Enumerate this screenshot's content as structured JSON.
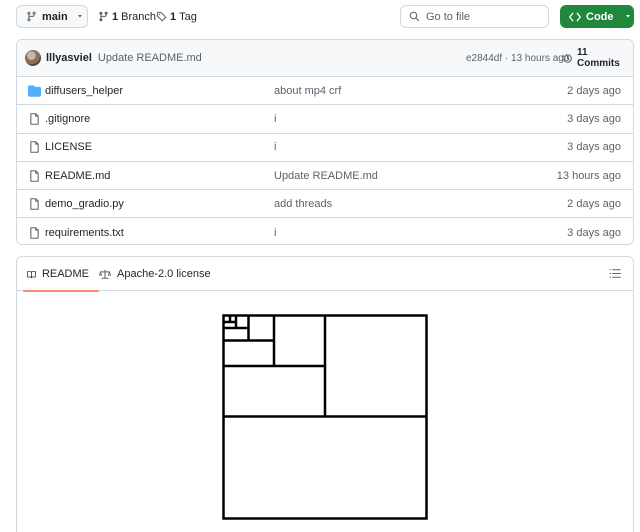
{
  "toolbar": {
    "branch_label": "main",
    "branches_count": "1",
    "branches_label": "Branch",
    "tags_count": "1",
    "tags_label": "Tag",
    "search_placeholder": "Go to file",
    "code_label": "Code"
  },
  "commit": {
    "author": "lllyasviel",
    "message": "Update README.md",
    "meta": "e2844df · 13 hours ago",
    "commits_label": "11 Commits"
  },
  "files": [
    {
      "type": "folder",
      "name": "diffusers_helper",
      "message": "about mp4 crf",
      "date": "2 days ago"
    },
    {
      "type": "file",
      "name": ".gitignore",
      "message": "i",
      "date": "3 days ago"
    },
    {
      "type": "file",
      "name": "LICENSE",
      "message": "i",
      "date": "3 days ago"
    },
    {
      "type": "file",
      "name": "README.md",
      "message": "Update README.md",
      "date": "13 hours ago"
    },
    {
      "type": "file",
      "name": "demo_gradio.py",
      "message": "add threads",
      "date": "2 days ago"
    },
    {
      "type": "file",
      "name": "requirements.txt",
      "message": "i",
      "date": "3 days ago"
    }
  ],
  "readme": {
    "tab_readme": "README",
    "tab_license": "Apache-2.0 license"
  },
  "colors": {
    "accent_green": "#1f883d",
    "folder_blue": "#54aeff",
    "tab_underline": "#fd8c73"
  }
}
